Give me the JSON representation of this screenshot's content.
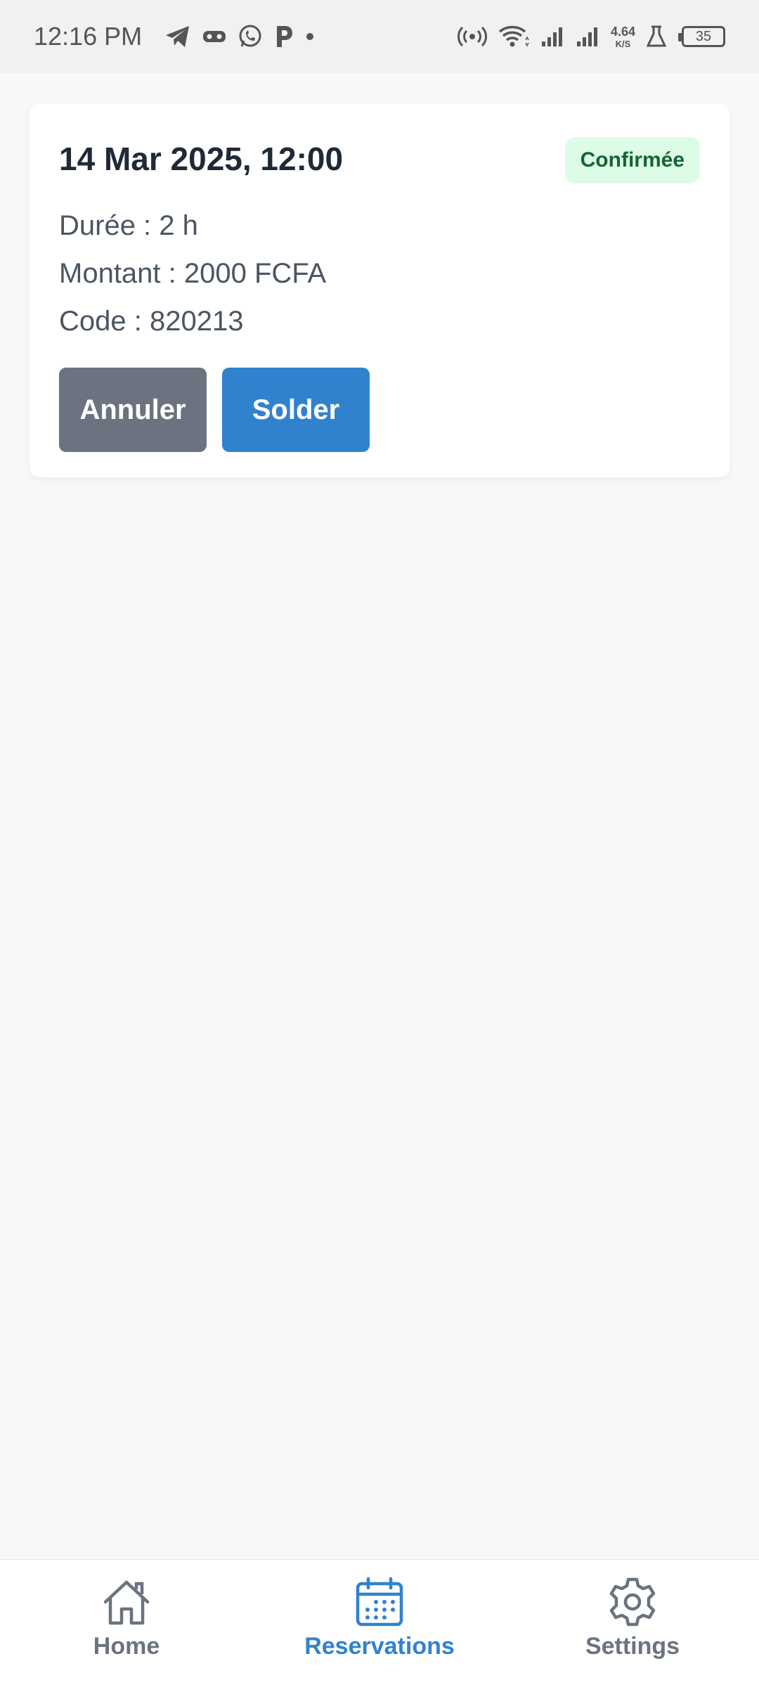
{
  "status_bar": {
    "time": "12:16 PM",
    "net_speed_value": "4.64",
    "net_speed_unit": "K/S",
    "battery": "35",
    "icons": [
      "telegram-icon",
      "game-icon",
      "whatsapp-icon",
      "parking-icon",
      "hotspot-icon",
      "wifi-icon",
      "signal-icon",
      "signal-icon",
      "lab-icon",
      "battery-icon"
    ]
  },
  "reservation": {
    "datetime": "14 Mar 2025, 12:00",
    "status": "Confirmée",
    "duration": "Durée : 2 h",
    "amount": "Montant : 2000 FCFA",
    "code": "Code : 820213",
    "cancel_label": "Annuler",
    "pay_label": "Solder"
  },
  "bottom_nav": {
    "items": [
      {
        "label": "Home",
        "icon": "home-icon",
        "active": false
      },
      {
        "label": "Reservations",
        "icon": "calendar-icon",
        "active": true
      },
      {
        "label": "Settings",
        "icon": "gear-icon",
        "active": false
      }
    ]
  },
  "colors": {
    "accent": "#3182ce",
    "cancel": "#6b7280",
    "badge_bg": "#dcfce7",
    "badge_text": "#166534"
  }
}
